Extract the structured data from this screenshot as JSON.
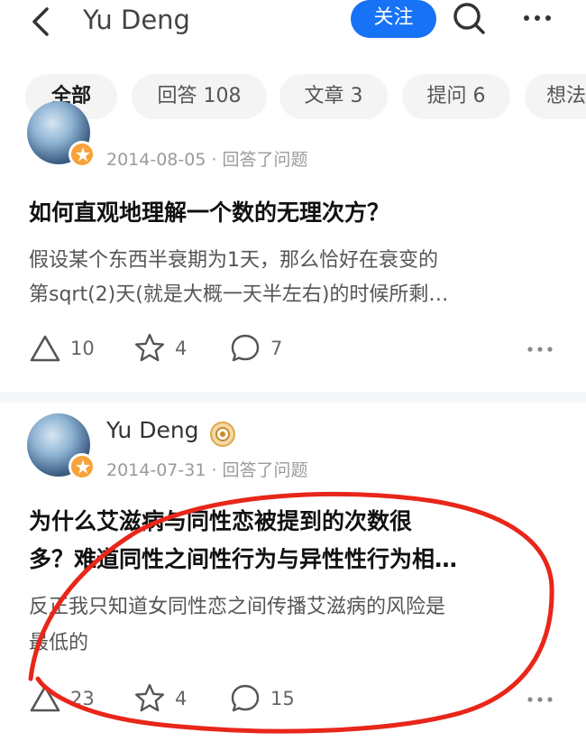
{
  "header": {
    "title": "Yu Deng",
    "follow_label": "关注"
  },
  "tabs": [
    {
      "label": "全部",
      "active": true
    },
    {
      "label": "回答 108"
    },
    {
      "label": "文章 3"
    },
    {
      "label": "提问 6"
    },
    {
      "label": "想法"
    }
  ],
  "items": [
    {
      "author": "",
      "meta": "2014-08-05 · 回答了问题",
      "title": "如何直观地理解一个数的无理次方？",
      "excerpt_line1": "假设某个东西半衰期为1天，那么恰好在衰变的",
      "excerpt_line2": "第sqrt(2)天(就是大概一天半左右)的时候所剩…",
      "likes": "10",
      "favorites": "4",
      "comments": "7"
    },
    {
      "author": "Yu Deng",
      "meta": "2014-07-31 · 回答了问题",
      "title_line1": "为什么艾滋病与同性恋被提到的次数很",
      "title_line2": "多？难道同性之间性行为与异性性行为相…",
      "excerpt_line1": "反正我只知道女同性恋之间传播艾滋病的风险是",
      "excerpt_line2": "最低的",
      "likes": "23",
      "favorites": "4",
      "comments": "15"
    }
  ],
  "colors": {
    "accent": "#1772f6",
    "annotation": "#e8261a",
    "badge": "#f7a23a"
  },
  "icons": [
    "back-arrow-icon",
    "search-icon",
    "more-icon",
    "like-triangle-icon",
    "star-icon",
    "comment-bubble-icon",
    "verified-badge-icon"
  ]
}
